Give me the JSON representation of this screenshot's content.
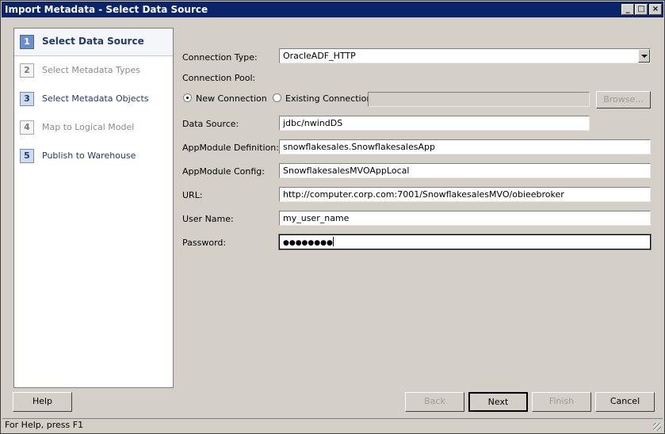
{
  "window": {
    "title": "Import Metadata - Select Data Source"
  },
  "titlebar_buttons": {
    "minimize": "_",
    "maximize": "□",
    "close": "×"
  },
  "steps": [
    {
      "number": "1",
      "label": "Select Data Source",
      "state": "active"
    },
    {
      "number": "2",
      "label": "Select Metadata Types",
      "state": "disabled"
    },
    {
      "number": "3",
      "label": "Select Metadata Objects",
      "state": "enabled"
    },
    {
      "number": "4",
      "label": "Map to Logical Model",
      "state": "disabled"
    },
    {
      "number": "5",
      "label": "Publish to Warehouse",
      "state": "enabled"
    }
  ],
  "form": {
    "connection_type_label": "Connection Type:",
    "connection_type_value": "OracleADF_HTTP",
    "connection_pool_label": "Connection Pool:",
    "new_connection_label": "New Connection",
    "new_connection_selected": true,
    "existing_connection_label": "Existing Connection",
    "existing_connection_value": "",
    "browse_label": "Browse...",
    "data_source_label": "Data Source:",
    "data_source_value": "jdbc/nwindDS",
    "appmodule_definition_label": "AppModule Definition:",
    "appmodule_definition_value": "snowflakesales.SnowflakesalesApp",
    "appmodule_config_label": "AppModule Config:",
    "appmodule_config_value": "SnowflakesalesMVOAppLocal",
    "url_label": "URL:",
    "url_value": "http://computer.corp.com:7001/SnowflakesalesMVO/obieebroker",
    "user_name_label": "User Name:",
    "user_name_value": "my_user_name",
    "password_label": "Password:",
    "password_value": "●●●●●●●●"
  },
  "buttons": {
    "help": "Help",
    "back": "Back",
    "next": "Next",
    "finish": "Finish",
    "cancel": "Cancel"
  },
  "status": {
    "text": "For Help, press F1"
  },
  "colors": {
    "titlebar": "#0a246a",
    "active_step": "#6b8fcf",
    "face": "#d4d0c8"
  }
}
